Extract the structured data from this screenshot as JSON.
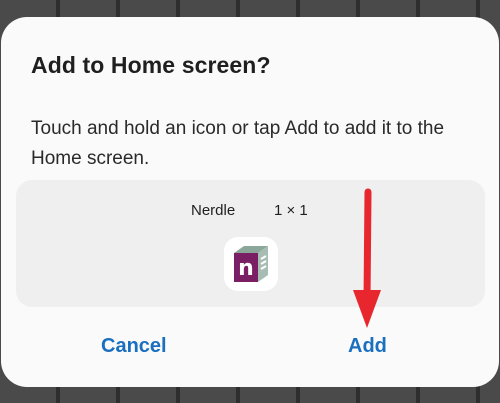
{
  "dialog": {
    "title": "Add to Home screen?",
    "message": "Touch and hold an icon or tap Add to add it to the Home screen."
  },
  "widget": {
    "name": "Nerdle",
    "size": "1 × 1",
    "icon": "nerdle-app-icon",
    "icon_letter": "n"
  },
  "buttons": {
    "cancel_label": "Cancel",
    "add_label": "Add"
  },
  "colors": {
    "accent": "#1b6fbf",
    "arrow": "#e8262e",
    "icon_purple": "#7a1f63",
    "icon_green": "#8aa79a"
  },
  "annotation": {
    "icon": "red-arrow-icon"
  }
}
